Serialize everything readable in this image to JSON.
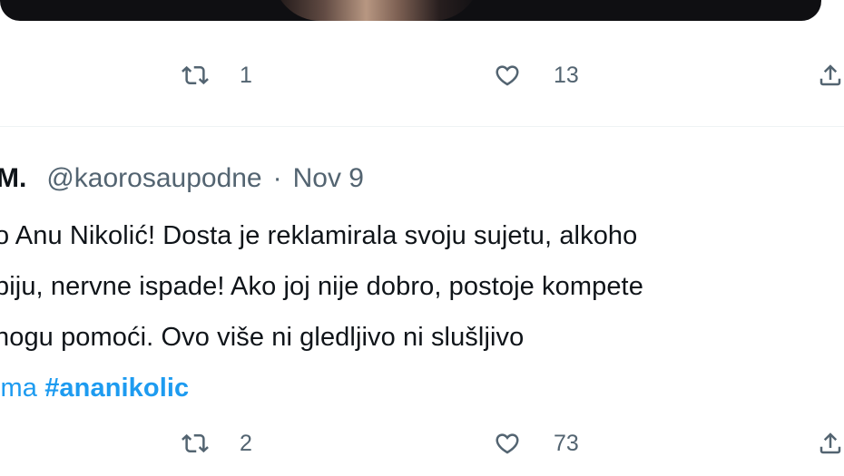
{
  "tweet_1": {
    "actions": {
      "retweet_count": "1",
      "like_count": "13"
    }
  },
  "tweet_2": {
    "author": {
      "display_name": "M.",
      "handle": "@kaorosaupodne"
    },
    "separator": "·",
    "timestamp": "Nov 9",
    "text_lines": [
      "o Anu Nikolić! Dosta je reklamirala svoju sujetu, alkoho",
      "piju, nervne ispade! Ako joj nije dobro, postoje kompete",
      "nogu pomoći. Ovo više ni gledljivo ni slušljivo"
    ],
    "hashtags": [
      "ima",
      "#ananikolic"
    ],
    "actions": {
      "retweet_count": "2",
      "like_count": "73"
    }
  },
  "icons": {
    "retweet": "retweet-icon",
    "like": "heart-icon",
    "share": "share-icon"
  },
  "colors": {
    "text_primary": "#0f1419",
    "text_secondary": "#536471",
    "link": "#1d9bf0",
    "divider": "#eff3f4"
  }
}
